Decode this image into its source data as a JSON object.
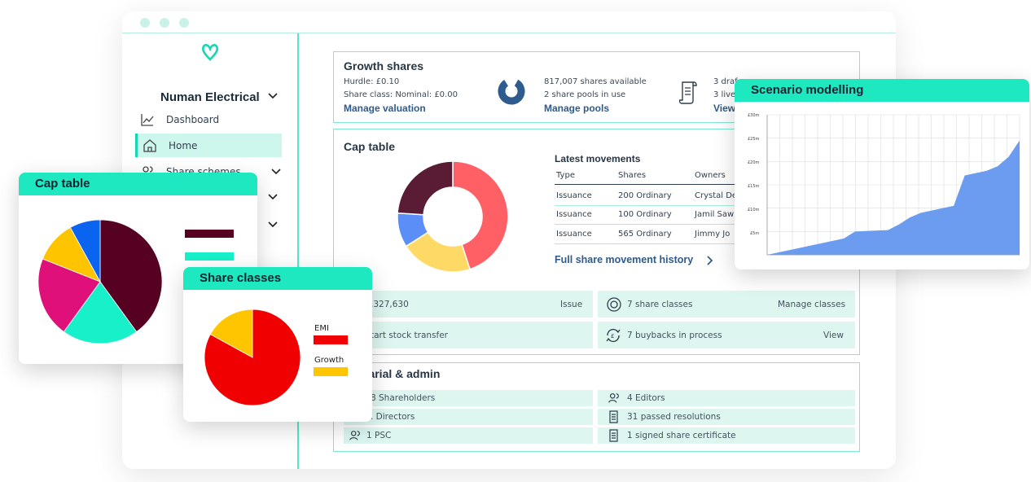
{
  "sidebar": {
    "company": "Numan Electrical",
    "items": [
      {
        "label": "Dashboard",
        "icon": "chart-line-icon"
      },
      {
        "label": "Home",
        "icon": "home-icon",
        "active": true
      },
      {
        "label": "Share schemes",
        "icon": "users-icon"
      }
    ]
  },
  "growth": {
    "title": "Growth shares",
    "hurdle": "Hurdle: £0.10",
    "share_class": "Share class: Nominal: £0.00",
    "manage_valuation": "Manage valuation",
    "shares_available": "817,007 shares available",
    "pools_in_use": "2 share pools in use",
    "manage_pools": "Manage pools",
    "drafts": "3 draf",
    "live": "3 live",
    "view": "View"
  },
  "cap": {
    "title": "Cap table",
    "movements_title": "Latest movements",
    "headers": [
      "Type",
      "Shares",
      "Owners"
    ],
    "rows": [
      [
        "Issuance",
        "200 Ordinary",
        "Crystal De"
      ],
      [
        "Issuance",
        "100 Ordinary",
        "Jamil Saw"
      ],
      [
        "Issuance",
        "565 Ordinary",
        "Jimmy Jo"
      ]
    ],
    "history_link": "Full share movement history",
    "donut_colors": [
      "#ff6066",
      "#ffd966",
      "#5b8ff7",
      "#5a1b35"
    ]
  },
  "actions": {
    "shares_value": ",327,630",
    "issue": "Issue",
    "share_classes": "7 share classes",
    "manage_classes": "Manage classes",
    "stock_transfer": "tart stock transfer",
    "buybacks": "7 buybacks in process",
    "view": "View"
  },
  "secretarial": {
    "title": "etarial & admin",
    "shareholders": "8 Shareholders",
    "editors": "4 Editors",
    "directors": ". Directors",
    "resolutions": "31 passed resolutions",
    "psc": "1 PSC",
    "certificate": "1 signed share certificate"
  },
  "cap_card": {
    "title": "Cap table",
    "colors": [
      "#560022",
      "#17f0c8",
      "#e0107a",
      "#ffc400",
      "#0a64f0"
    ]
  },
  "share_classes_card": {
    "title": "Share classes",
    "legend": [
      {
        "label": "EMI",
        "color": "#f00000"
      },
      {
        "label": "Growth",
        "color": "#ffc600"
      }
    ]
  },
  "scenario_card": {
    "title": "Scenario modelling",
    "y_ticks": [
      "£30m",
      "£25m",
      "£20m",
      "£15m",
      "£10m",
      "£5m"
    ]
  },
  "chart_data": [
    {
      "type": "pie",
      "title": "Cap table",
      "values": [
        40,
        20,
        21,
        11,
        8
      ],
      "colors": [
        "#560022",
        "#17f0c8",
        "#e0107a",
        "#ffc400",
        "#0a64f0"
      ]
    },
    {
      "type": "pie",
      "title": "Share classes",
      "categories": [
        "EMI",
        "Growth"
      ],
      "values": [
        83,
        17
      ],
      "colors": [
        "#f00000",
        "#ffc600"
      ]
    },
    {
      "type": "pie",
      "title": "Cap table",
      "values": [
        45,
        21,
        10,
        24
      ],
      "colors": [
        "#ff6066",
        "#ffd966",
        "#5b8ff7",
        "#5a1b35"
      ]
    },
    {
      "type": "area",
      "title": "Scenario modelling",
      "ylim": [
        0,
        30
      ],
      "x": [
        0,
        1,
        2,
        3,
        4,
        5,
        6,
        7,
        8,
        9,
        10,
        11,
        12,
        13,
        14,
        15,
        16,
        17,
        18,
        19,
        20,
        21,
        22,
        23
      ],
      "values": [
        0,
        0.5,
        1,
        1.5,
        2,
        2.5,
        3,
        3.5,
        5,
        5.1,
        5.2,
        5.3,
        6.5,
        8,
        9,
        9.5,
        10,
        10.5,
        17,
        17.5,
        18,
        19,
        21,
        24.5
      ]
    }
  ]
}
